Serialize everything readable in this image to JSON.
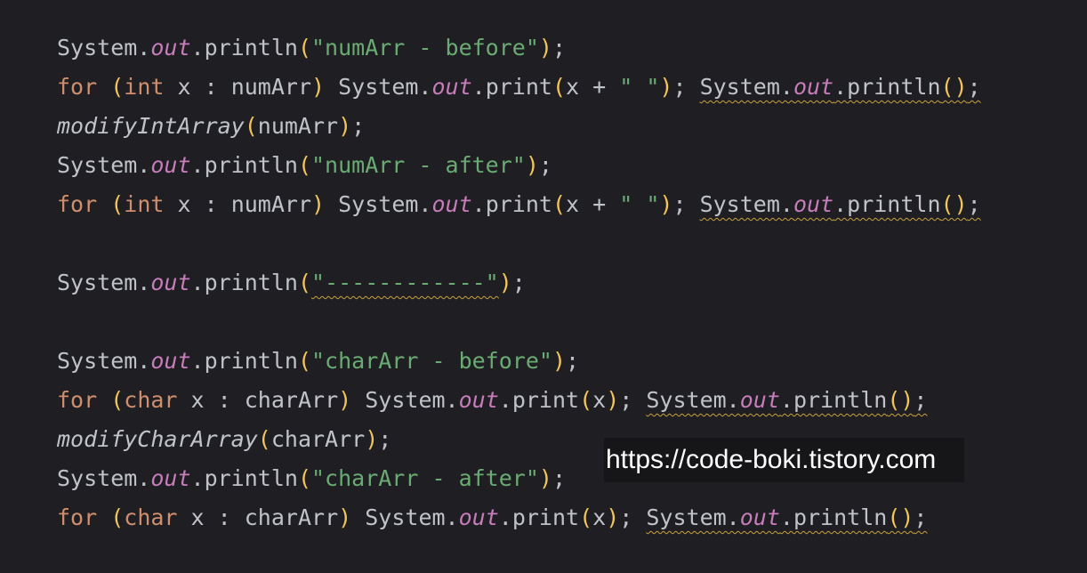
{
  "code_lines": [
    [
      {
        "t": "System.",
        "c": "plain"
      },
      {
        "t": "out",
        "c": "field"
      },
      {
        "t": ".println",
        "c": "plain"
      },
      {
        "t": "(",
        "c": "paren"
      },
      {
        "t": "\"numArr - before\"",
        "c": "string"
      },
      {
        "t": ")",
        "c": "paren"
      },
      {
        "t": ";",
        "c": "plain"
      }
    ],
    [
      {
        "t": "for",
        "c": "keyword"
      },
      {
        "t": " ",
        "c": "plain"
      },
      {
        "t": "(",
        "c": "paren"
      },
      {
        "t": "int",
        "c": "keyword"
      },
      {
        "t": " x : numArr",
        "c": "plain"
      },
      {
        "t": ")",
        "c": "paren"
      },
      {
        "t": " System.",
        "c": "plain"
      },
      {
        "t": "out",
        "c": "field"
      },
      {
        "t": ".print",
        "c": "plain"
      },
      {
        "t": "(",
        "c": "paren"
      },
      {
        "t": "x + ",
        "c": "plain"
      },
      {
        "t": "\" \"",
        "c": "string"
      },
      {
        "t": ")",
        "c": "paren"
      },
      {
        "t": "; ",
        "c": "plain"
      },
      {
        "t": "System.",
        "c": "plain",
        "w": true
      },
      {
        "t": "out",
        "c": "field",
        "w": true
      },
      {
        "t": ".println",
        "c": "plain",
        "w": true
      },
      {
        "t": "()",
        "c": "paren",
        "w": true
      },
      {
        "t": ";",
        "c": "plain",
        "w": true
      }
    ],
    [
      {
        "t": "modifyIntArray",
        "c": "method-italic"
      },
      {
        "t": "(",
        "c": "paren"
      },
      {
        "t": "numArr",
        "c": "plain"
      },
      {
        "t": ")",
        "c": "paren"
      },
      {
        "t": ";",
        "c": "plain"
      }
    ],
    [
      {
        "t": "System.",
        "c": "plain"
      },
      {
        "t": "out",
        "c": "field"
      },
      {
        "t": ".println",
        "c": "plain"
      },
      {
        "t": "(",
        "c": "paren"
      },
      {
        "t": "\"numArr - after\"",
        "c": "string"
      },
      {
        "t": ")",
        "c": "paren"
      },
      {
        "t": ";",
        "c": "plain"
      }
    ],
    [
      {
        "t": "for",
        "c": "keyword"
      },
      {
        "t": " ",
        "c": "plain"
      },
      {
        "t": "(",
        "c": "paren"
      },
      {
        "t": "int",
        "c": "keyword"
      },
      {
        "t": " x : numArr",
        "c": "plain"
      },
      {
        "t": ")",
        "c": "paren"
      },
      {
        "t": " System.",
        "c": "plain"
      },
      {
        "t": "out",
        "c": "field"
      },
      {
        "t": ".print",
        "c": "plain"
      },
      {
        "t": "(",
        "c": "paren"
      },
      {
        "t": "x + ",
        "c": "plain"
      },
      {
        "t": "\" \"",
        "c": "string"
      },
      {
        "t": ")",
        "c": "paren"
      },
      {
        "t": "; ",
        "c": "plain"
      },
      {
        "t": "System.",
        "c": "plain",
        "w": true
      },
      {
        "t": "out",
        "c": "field",
        "w": true
      },
      {
        "t": ".println",
        "c": "plain",
        "w": true
      },
      {
        "t": "()",
        "c": "paren",
        "w": true
      },
      {
        "t": ";",
        "c": "plain",
        "w": true
      }
    ],
    [],
    [
      {
        "t": "System.",
        "c": "plain"
      },
      {
        "t": "out",
        "c": "field"
      },
      {
        "t": ".println",
        "c": "plain"
      },
      {
        "t": "(",
        "c": "paren"
      },
      {
        "t": "\"------------\"",
        "c": "string",
        "w": true
      },
      {
        "t": ")",
        "c": "paren"
      },
      {
        "t": ";",
        "c": "plain"
      }
    ],
    [],
    [
      {
        "t": "System.",
        "c": "plain"
      },
      {
        "t": "out",
        "c": "field"
      },
      {
        "t": ".println",
        "c": "plain"
      },
      {
        "t": "(",
        "c": "paren"
      },
      {
        "t": "\"charArr - before\"",
        "c": "string"
      },
      {
        "t": ")",
        "c": "paren"
      },
      {
        "t": ";",
        "c": "plain"
      }
    ],
    [
      {
        "t": "for",
        "c": "keyword"
      },
      {
        "t": " ",
        "c": "plain"
      },
      {
        "t": "(",
        "c": "paren"
      },
      {
        "t": "char",
        "c": "keyword"
      },
      {
        "t": " x : charArr",
        "c": "plain"
      },
      {
        "t": ")",
        "c": "paren"
      },
      {
        "t": " System.",
        "c": "plain"
      },
      {
        "t": "out",
        "c": "field"
      },
      {
        "t": ".print",
        "c": "plain"
      },
      {
        "t": "(",
        "c": "paren"
      },
      {
        "t": "x",
        "c": "plain"
      },
      {
        "t": ")",
        "c": "paren"
      },
      {
        "t": "; ",
        "c": "plain"
      },
      {
        "t": "System.",
        "c": "plain",
        "w": true
      },
      {
        "t": "out",
        "c": "field",
        "w": true
      },
      {
        "t": ".println",
        "c": "plain",
        "w": true
      },
      {
        "t": "()",
        "c": "paren",
        "w": true
      },
      {
        "t": ";",
        "c": "plain",
        "w": true
      }
    ],
    [
      {
        "t": "modifyCharArray",
        "c": "method-italic"
      },
      {
        "t": "(",
        "c": "paren"
      },
      {
        "t": "charArr",
        "c": "plain"
      },
      {
        "t": ")",
        "c": "paren"
      },
      {
        "t": ";",
        "c": "plain"
      }
    ],
    [
      {
        "t": "System.",
        "c": "plain"
      },
      {
        "t": "out",
        "c": "field"
      },
      {
        "t": ".println",
        "c": "plain"
      },
      {
        "t": "(",
        "c": "paren"
      },
      {
        "t": "\"charArr - after\"",
        "c": "string"
      },
      {
        "t": ")",
        "c": "paren"
      },
      {
        "t": ";",
        "c": "plain"
      }
    ],
    [
      {
        "t": "for",
        "c": "keyword"
      },
      {
        "t": " ",
        "c": "plain"
      },
      {
        "t": "(",
        "c": "paren"
      },
      {
        "t": "char",
        "c": "keyword"
      },
      {
        "t": " x : charArr",
        "c": "plain"
      },
      {
        "t": ")",
        "c": "paren"
      },
      {
        "t": " System.",
        "c": "plain"
      },
      {
        "t": "out",
        "c": "field"
      },
      {
        "t": ".print",
        "c": "plain"
      },
      {
        "t": "(",
        "c": "paren"
      },
      {
        "t": "x",
        "c": "plain"
      },
      {
        "t": ")",
        "c": "paren"
      },
      {
        "t": "; ",
        "c": "plain"
      },
      {
        "t": "System.",
        "c": "plain",
        "w": true
      },
      {
        "t": "out",
        "c": "field",
        "w": true
      },
      {
        "t": ".println",
        "c": "plain",
        "w": true
      },
      {
        "t": "()",
        "c": "paren",
        "w": true
      },
      {
        "t": ";",
        "c": "plain",
        "w": true
      }
    ]
  ],
  "watermark": {
    "text": "https://code-boki.tistory.com"
  },
  "colors": {
    "background": "#1f1f23",
    "plain": "#bfc3c9",
    "field": "#c77dbb",
    "string": "#6aab73",
    "keyword": "#cf8e6d",
    "paren": "#f2c55c",
    "warning_underline": "#c9a13c",
    "watermark_bg": "#161618",
    "watermark_text": "#ffffff"
  }
}
